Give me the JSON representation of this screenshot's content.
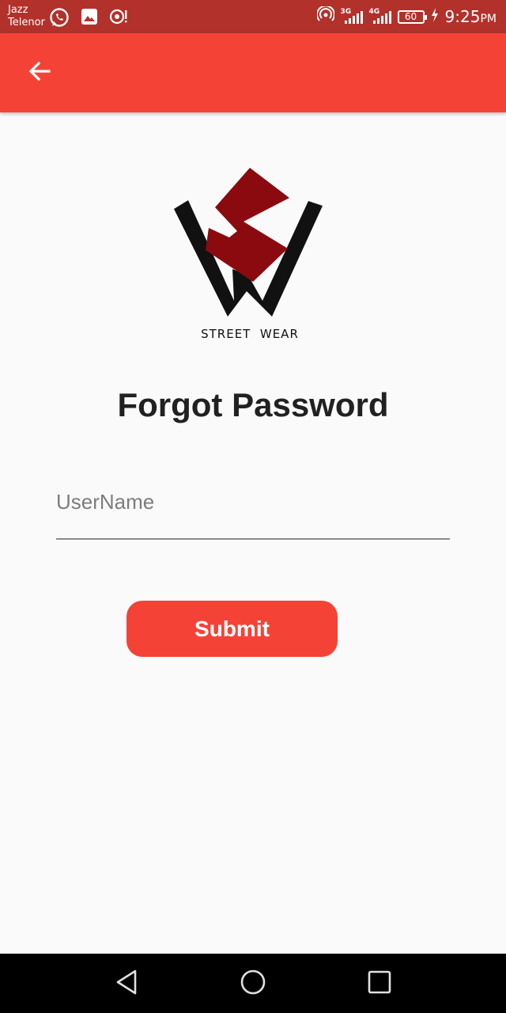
{
  "status_bar": {
    "carrier_line1": "Jazz",
    "carrier_line2": "Telenor",
    "network1": "3G",
    "network2": "4G",
    "battery": "60",
    "time": "9:25",
    "ampm": "PM"
  },
  "app_bar": {
    "background": "#f44336",
    "back_icon": "arrow-back-icon"
  },
  "logo": {
    "text": "STREET  WEAR",
    "accent": "#8b0a0f"
  },
  "page": {
    "title": "Forgot Password"
  },
  "form": {
    "username_placeholder": "UserName",
    "username_value": "",
    "submit_label": "Submit"
  },
  "nav_bar": {
    "buttons": [
      "back-triangle-icon",
      "home-circle-icon",
      "recents-square-icon"
    ]
  }
}
